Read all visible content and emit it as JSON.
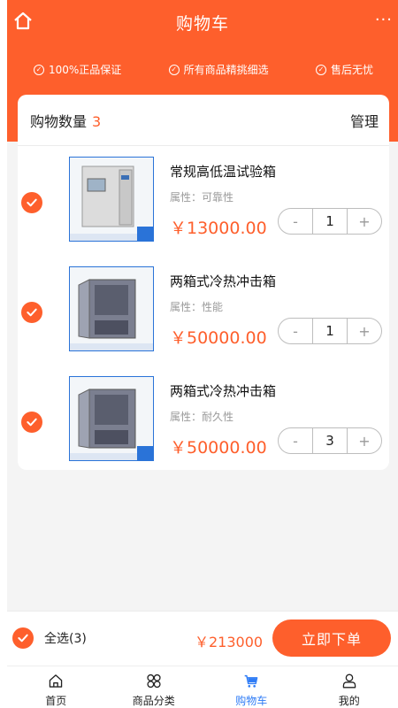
{
  "header": {
    "title": "购物车",
    "more": "···",
    "guarantees": [
      "100%正品保证",
      "所有商品精挑细选",
      "售后无忧"
    ]
  },
  "cart": {
    "count_label": "购物数量",
    "count": "3",
    "manage_label": "管理",
    "items": [
      {
        "name": "常规高低温试验箱",
        "attr": "属性：可靠性",
        "price": "￥13000.00",
        "qty": "1",
        "minus": "-",
        "plus": "+",
        "image": "climate-test-chamber-white",
        "door_color": "#e8e8e8"
      },
      {
        "name": "两箱式冷热冲击箱",
        "attr": "属性：性能",
        "price": "￥50000.00",
        "qty": "1",
        "minus": "-",
        "plus": "+",
        "image": "thermal-shock-chamber-blue",
        "door_color": "#8c90a0"
      },
      {
        "name": "两箱式冷热冲击箱",
        "attr": "属性：耐久性",
        "price": "￥50000.00",
        "qty": "3",
        "minus": "-",
        "plus": "+",
        "image": "thermal-shock-chamber-blue",
        "door_color": "#8c90a0"
      }
    ]
  },
  "footer": {
    "select_all_label": "全选(3)",
    "total": "￥213000",
    "checkout_label": "立即下单"
  },
  "tabs": [
    {
      "label": "首页",
      "icon": "home-icon"
    },
    {
      "label": "商品分类",
      "icon": "category-icon"
    },
    {
      "label": "购物车",
      "icon": "cart-icon"
    },
    {
      "label": "我的",
      "icon": "user-icon"
    }
  ],
  "colors": {
    "accent": "#fe5f2c",
    "active_tab": "#2f7cf6"
  }
}
